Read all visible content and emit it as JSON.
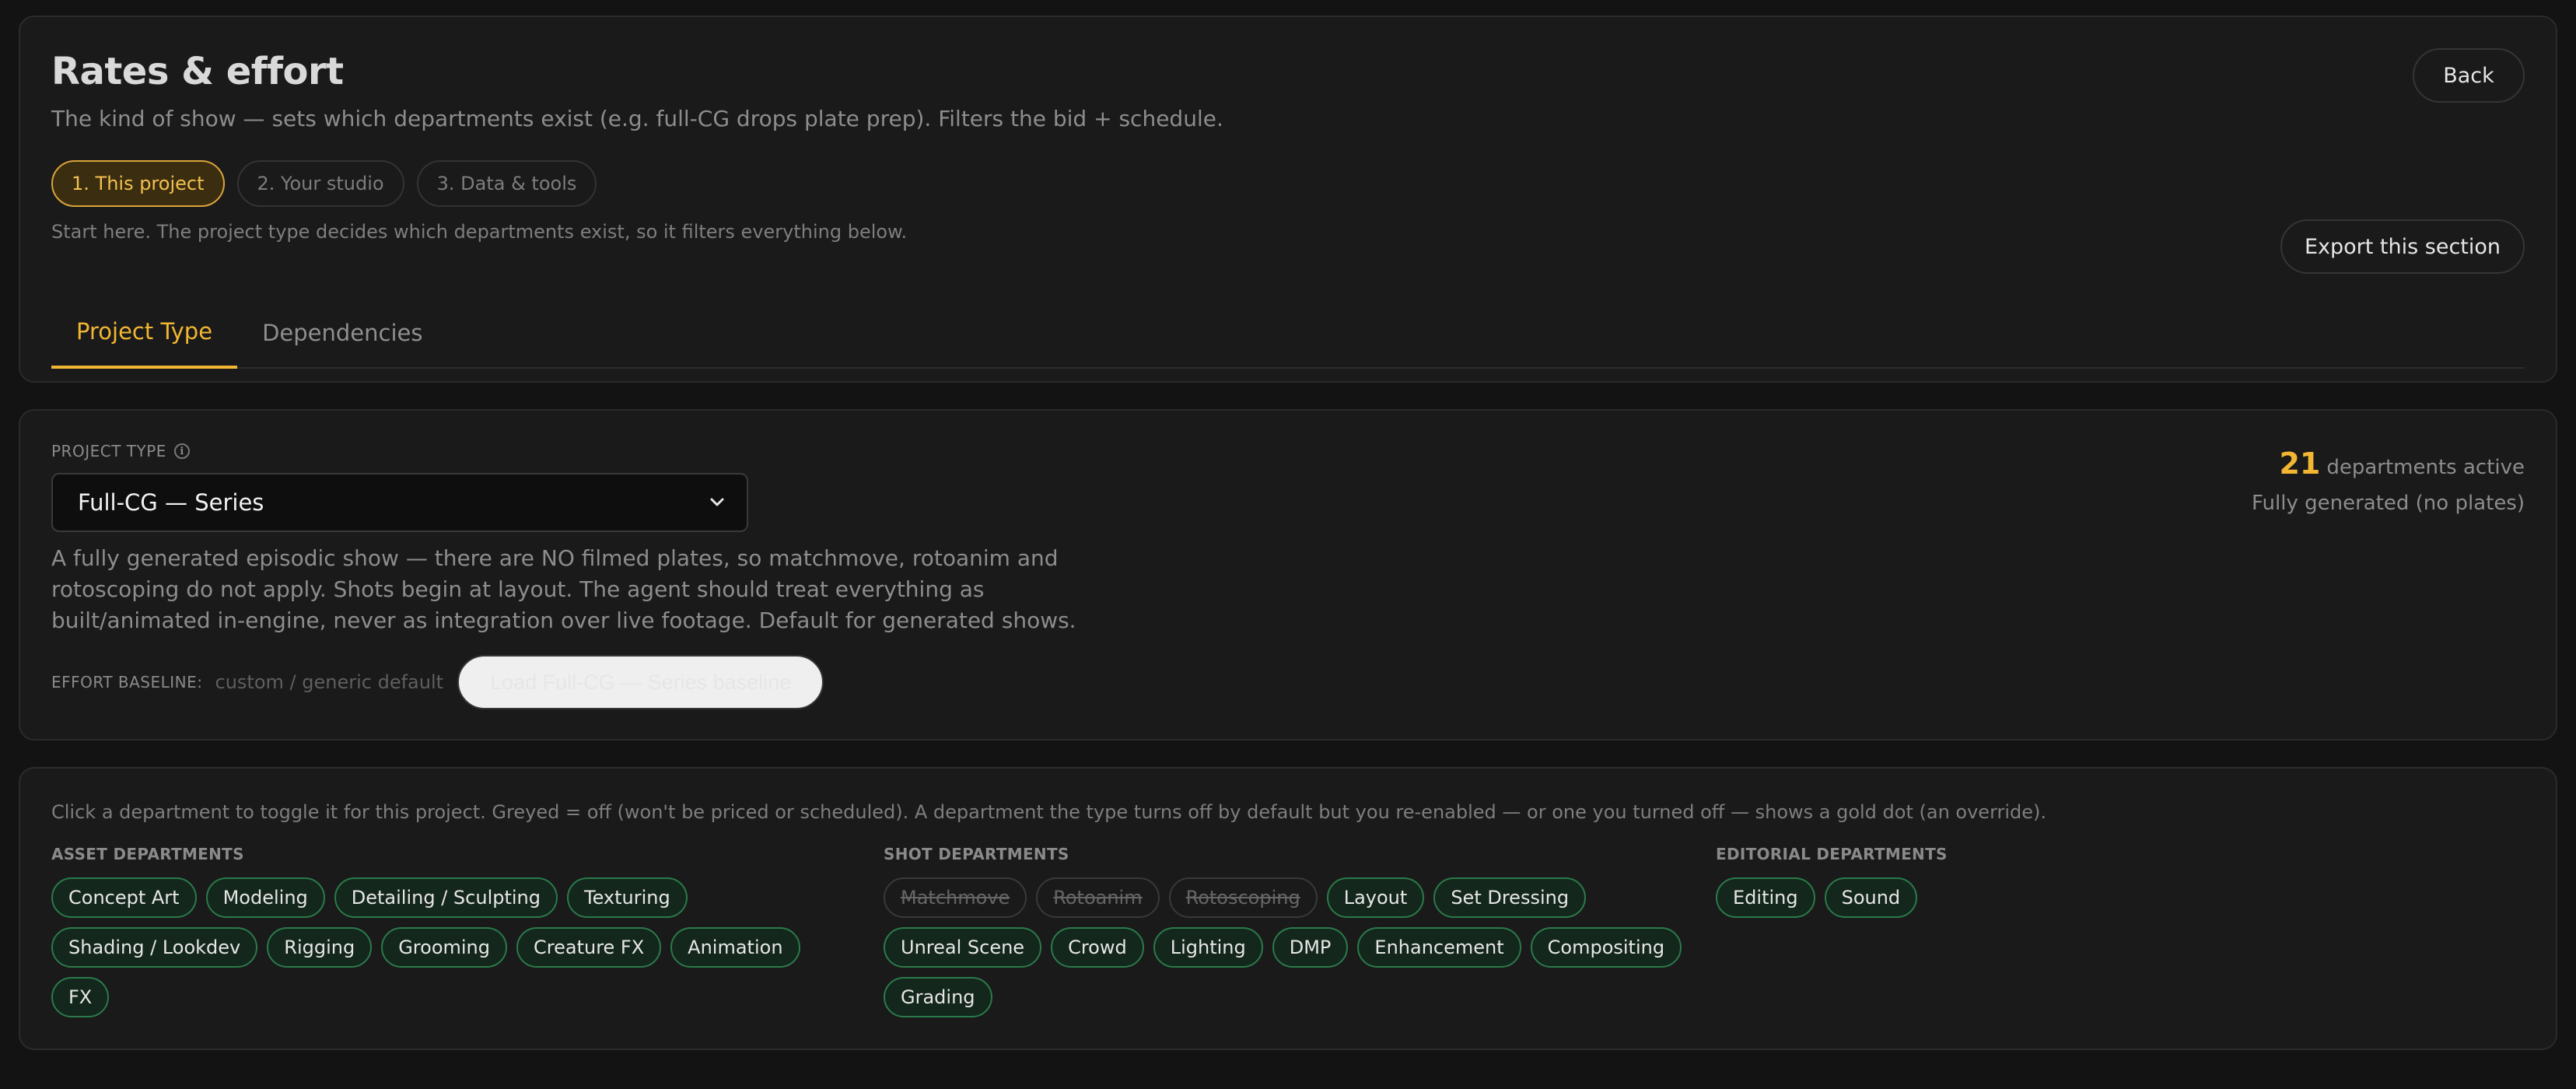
{
  "header": {
    "title": "Rates & effort",
    "subtitle": "The kind of show — sets which departments exist (e.g. full-CG drops plate prep). Filters the bid + schedule.",
    "back_label": "Back",
    "export_label": "Export this section",
    "steps": [
      {
        "label": "1. This project",
        "active": true
      },
      {
        "label": "2. Your studio",
        "active": false
      },
      {
        "label": "3. Data & tools",
        "active": false
      }
    ],
    "steps_hint": "Start here. The project type decides which departments exist, so it filters everything below.",
    "tabs": [
      {
        "label": "Project Type",
        "active": true
      },
      {
        "label": "Dependencies",
        "active": false
      }
    ]
  },
  "project_type": {
    "label": "PROJECT TYPE",
    "selected": "Full-CG — Series",
    "description": "A fully generated episodic show — there are NO filmed plates, so matchmove, rotoanim and rotoscoping do not apply. Shots begin at layout. The agent should treat everything as built/animated in-engine, never as integration over live footage. Default for generated shows.",
    "baseline_label": "EFFORT BASELINE:",
    "baseline_value": "custom / generic default",
    "load_baseline_label": "Load Full-CG — Series baseline",
    "active_count": "21",
    "active_count_suffix": "departments active",
    "summary": "Fully generated (no plates)"
  },
  "departments": {
    "hint": "Click a department to toggle it for this project. Greyed = off (won't be priced or scheduled). A department the type turns off by default but you re-enabled — or one you turned off — shows a gold dot (an override).",
    "asset": {
      "title": "ASSET DEPARTMENTS",
      "items": [
        {
          "label": "Concept Art",
          "on": true
        },
        {
          "label": "Modeling",
          "on": true
        },
        {
          "label": "Detailing / Sculpting",
          "on": true
        },
        {
          "label": "Texturing",
          "on": true
        },
        {
          "label": "Shading / Lookdev",
          "on": true
        },
        {
          "label": "Rigging",
          "on": true
        },
        {
          "label": "Grooming",
          "on": true
        },
        {
          "label": "Creature FX",
          "on": true
        },
        {
          "label": "Animation",
          "on": true
        },
        {
          "label": "FX",
          "on": true
        }
      ]
    },
    "shot": {
      "title": "SHOT DEPARTMENTS",
      "items": [
        {
          "label": "Matchmove",
          "on": false
        },
        {
          "label": "Rotoanim",
          "on": false
        },
        {
          "label": "Rotoscoping",
          "on": false
        },
        {
          "label": "Layout",
          "on": true
        },
        {
          "label": "Set Dressing",
          "on": true
        },
        {
          "label": "Unreal Scene",
          "on": true
        },
        {
          "label": "Crowd",
          "on": true
        },
        {
          "label": "Lighting",
          "on": true
        },
        {
          "label": "DMP",
          "on": true
        },
        {
          "label": "Enhancement",
          "on": true
        },
        {
          "label": "Compositing",
          "on": true
        },
        {
          "label": "Grading",
          "on": true
        }
      ]
    },
    "editorial": {
      "title": "EDITORIAL DEPARTMENTS",
      "items": [
        {
          "label": "Editing",
          "on": true
        },
        {
          "label": "Sound",
          "on": true
        }
      ]
    }
  }
}
